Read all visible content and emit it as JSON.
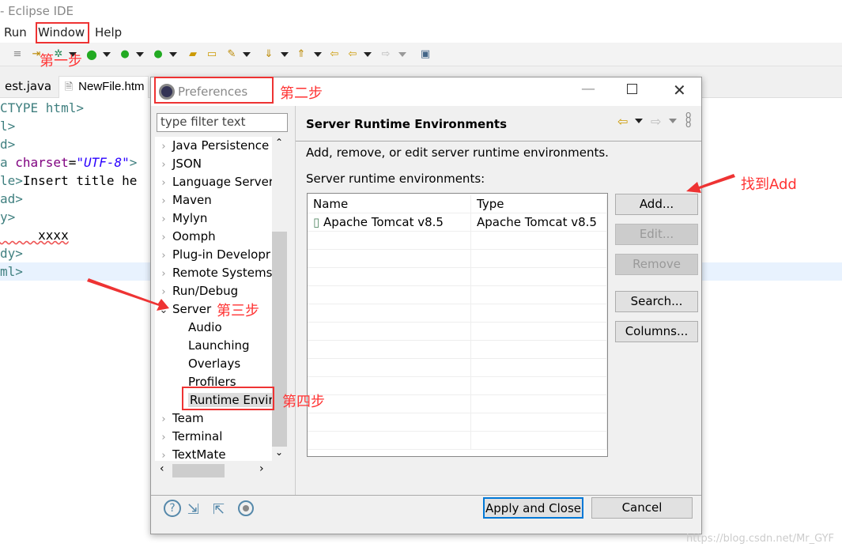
{
  "window": {
    "title": "- Eclipse IDE"
  },
  "menubar": {
    "items": [
      "Run",
      "Window",
      "Help"
    ]
  },
  "editor": {
    "tabs": [
      "est.java",
      "NewFile.htm"
    ],
    "lines": [
      {
        "a": "CTYPE html>"
      },
      {
        "a": "l>"
      },
      {
        "a": "d>"
      },
      {
        "a": "a ",
        "b": "charset",
        "c": "=",
        "d": "\"UTF-8\"",
        "e": ">"
      },
      {
        "a": "le>",
        "f": "Insert title he"
      },
      {
        "a": "ad>"
      },
      {
        "a": "y>"
      },
      {
        "f": "     xxxx"
      },
      {
        "a": "dy>"
      },
      {
        "a": "ml>"
      }
    ]
  },
  "dialog": {
    "title": "Preferences",
    "filter_placeholder": "type filter text",
    "tree": [
      {
        "label": "Java Persistence",
        "expanded": false
      },
      {
        "label": "JSON",
        "expanded": false
      },
      {
        "label": "Language Server",
        "expanded": false
      },
      {
        "label": "Maven",
        "expanded": false
      },
      {
        "label": "Mylyn",
        "expanded": false
      },
      {
        "label": "Oomph",
        "expanded": false
      },
      {
        "label": "Plug-in Developr",
        "expanded": false
      },
      {
        "label": "Remote Systems",
        "expanded": false
      },
      {
        "label": "Run/Debug",
        "expanded": false
      },
      {
        "label": "Server",
        "expanded": true
      },
      {
        "label": "Audio",
        "child": true
      },
      {
        "label": "Launching",
        "child": true
      },
      {
        "label": "Overlays",
        "child": true
      },
      {
        "label": "Profilers",
        "child": true
      },
      {
        "label": "Runtime Envir",
        "child": true,
        "selected": true
      },
      {
        "label": "Team",
        "expanded": false
      },
      {
        "label": "Terminal",
        "expanded": false
      },
      {
        "label": "TextMate",
        "expanded": false
      }
    ],
    "page": {
      "title": "Server Runtime Environments",
      "description": "Add, remove, or edit server runtime environments.",
      "list_label": "Server runtime environments:",
      "columns": [
        "Name",
        "Type"
      ],
      "rows": [
        {
          "name": "Apache Tomcat v8.5",
          "type": "Apache Tomcat v8.5"
        }
      ],
      "buttons": {
        "add": "Add...",
        "edit": "Edit...",
        "remove": "Remove",
        "search": "Search...",
        "columns": "Columns..."
      }
    },
    "footer": {
      "apply_close": "Apply and Close",
      "cancel": "Cancel"
    }
  },
  "annotations": {
    "step1": "第一步",
    "step2": "第二步",
    "step3": "第三步",
    "step4": "第四步",
    "find_add": "找到Add",
    "color": "#ee3333"
  },
  "watermark": "https://blog.csdn.net/Mr_GYF"
}
